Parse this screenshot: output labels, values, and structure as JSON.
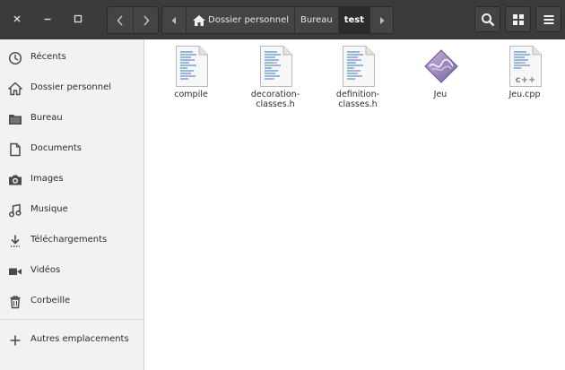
{
  "window_controls": {
    "close": "×",
    "minimize": "–",
    "maximize": "□"
  },
  "navigation": {
    "back_icon": "chevron-left-icon",
    "forward_icon": "chevron-right-icon"
  },
  "pathbar": {
    "items": [
      {
        "label": "Dossier personnel",
        "icon": "home-icon"
      },
      {
        "label": "Bureau"
      },
      {
        "label": "test",
        "active": true
      }
    ]
  },
  "toolbar": {
    "search_icon": "search-icon",
    "view_icon": "grid-view-icon",
    "menu_icon": "hamburger-menu-icon"
  },
  "sidebar": {
    "items": [
      {
        "label": "Récents",
        "icon": "clock-icon"
      },
      {
        "label": "Dossier personnel",
        "icon": "home-icon"
      },
      {
        "label": "Bureau",
        "icon": "folder-icon"
      },
      {
        "label": "Documents",
        "icon": "document-icon"
      },
      {
        "label": "Images",
        "icon": "camera-icon"
      },
      {
        "label": "Musique",
        "icon": "music-icon"
      },
      {
        "label": "Téléchargements",
        "icon": "download-icon"
      },
      {
        "label": "Vidéos",
        "icon": "video-icon"
      },
      {
        "label": "Corbeille",
        "icon": "trash-icon"
      }
    ],
    "other_locations": {
      "label": "Autres emplacements",
      "icon": "plus-icon"
    }
  },
  "files": [
    {
      "name": "compile",
      "type": "text-file-icon"
    },
    {
      "name": "decoration-classes.h",
      "line1": "decoration-",
      "line2": "classes.h",
      "type": "header-file-icon"
    },
    {
      "name": "definition-classes.h",
      "line1": "definition-",
      "line2": "classes.h",
      "type": "header-file-icon"
    },
    {
      "name": "Jeu",
      "type": "executable-icon"
    },
    {
      "name": "Jeu.cpp",
      "type": "cpp-file-icon",
      "badge": "c++"
    }
  ],
  "colors": {
    "headerbar": "#3b3b3b",
    "sidebar": "#f2f2f2",
    "view": "#ffffff",
    "exec_icon": "#9c86b9"
  }
}
